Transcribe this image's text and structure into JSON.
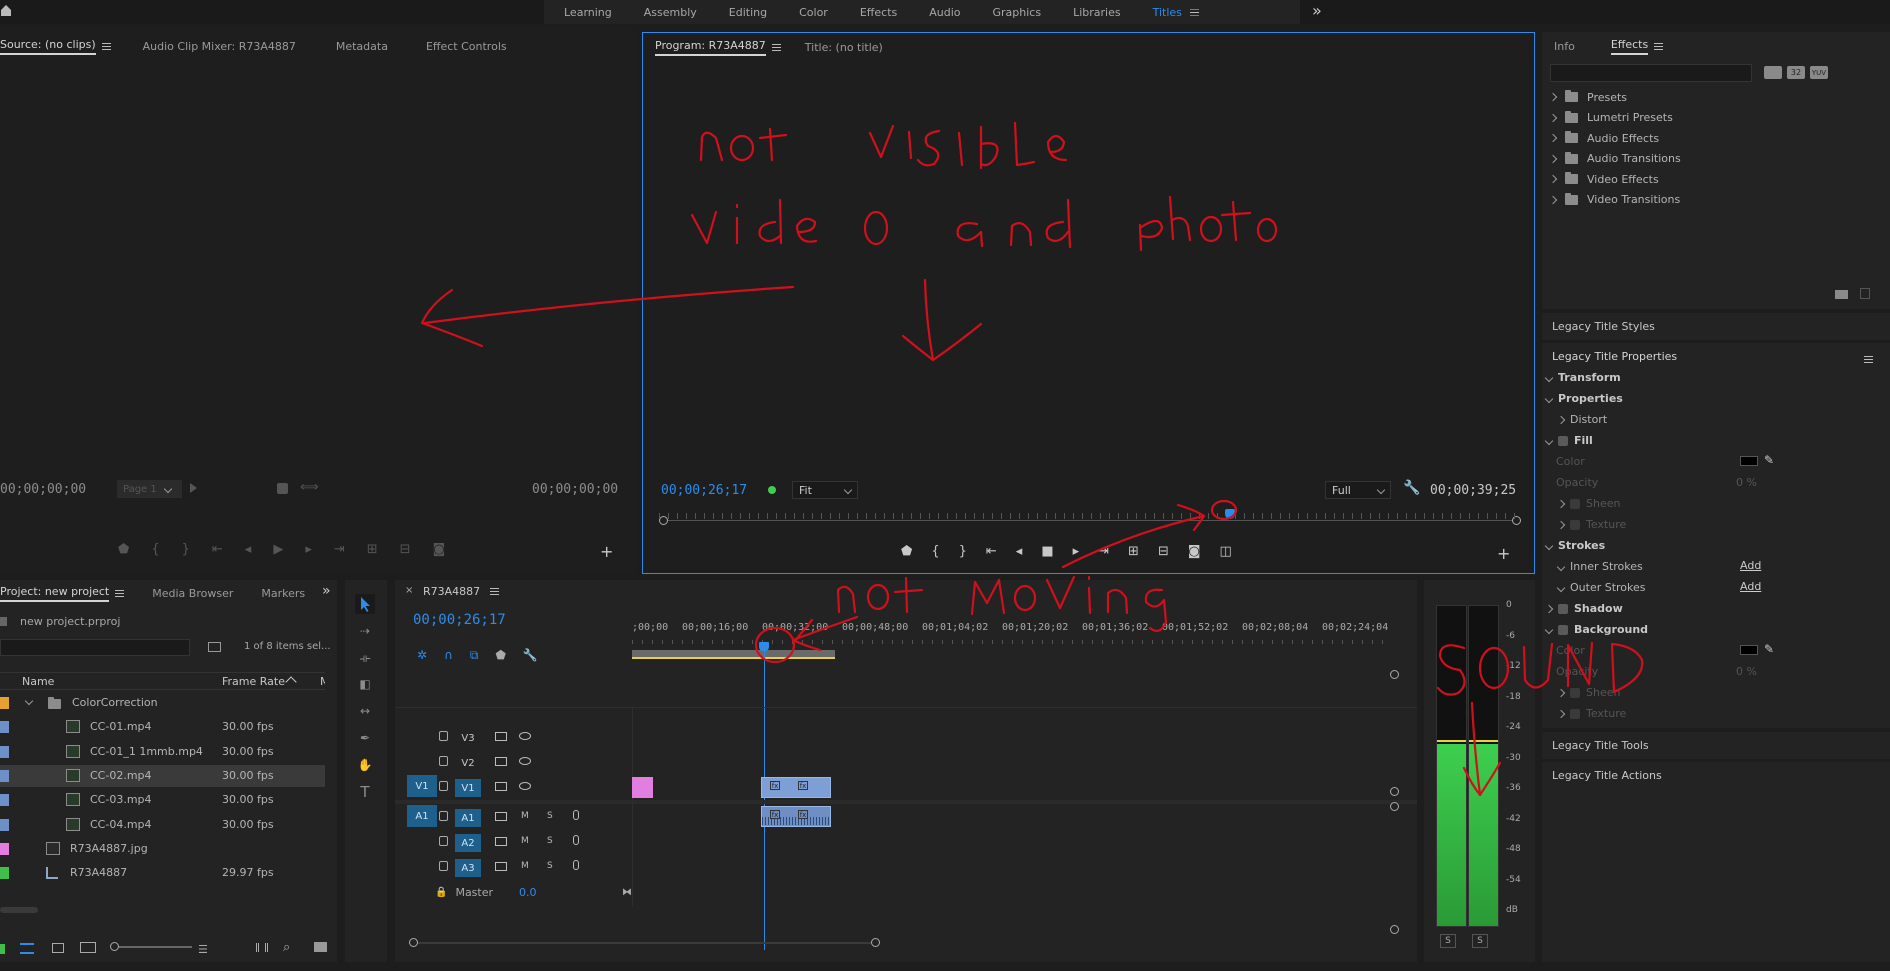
{
  "workspaces": {
    "items": [
      "Learning",
      "Assembly",
      "Editing",
      "Color",
      "Effects",
      "Audio",
      "Graphics",
      "Libraries",
      "Titles"
    ],
    "active": "Titles",
    "overflow": "»"
  },
  "source_panel": {
    "tabs": [
      "Source: (no clips)",
      "Audio Clip Mixer: R73A4887",
      "Metadata",
      "Effect Controls"
    ],
    "timecode_left": "00;00;00;00",
    "page_select": "Page 1",
    "timecode_right": "00;00;00;00"
  },
  "program_panel": {
    "tabs": [
      "Program: R73A4887",
      "Title: (no title)"
    ],
    "timecode": "00;00;26;17",
    "zoom": "Fit",
    "quality": "Full",
    "duration": "00;00;39;25"
  },
  "effects_panel": {
    "tabs": [
      "Info",
      "Effects"
    ],
    "items": [
      "Presets",
      "Lumetri Presets",
      "Audio Effects",
      "Audio Transitions",
      "Video Effects",
      "Video Transitions"
    ],
    "badge_32": "32",
    "badge_yuv": "YUV"
  },
  "legacy_title": {
    "styles": "Legacy Title Styles",
    "properties": "Legacy Title Properties",
    "transform": "Transform",
    "properties_section": "Properties",
    "distort": "Distort",
    "fill": "Fill",
    "color": "Color",
    "opacity": "Opacity",
    "opacity_value": "0 %",
    "sheen": "Sheen",
    "texture": "Texture",
    "strokes": "Strokes",
    "inner_strokes": "Inner Strokes",
    "outer_strokes": "Outer Strokes",
    "add": "Add",
    "shadow": "Shadow",
    "background": "Background",
    "bg_color": "Color",
    "bg_opacity": "Opacity",
    "bg_opacity_value": "0 %",
    "bg_sheen": "Sheen",
    "bg_texture": "Texture",
    "tools": "Legacy Title Tools",
    "actions": "Legacy Title Actions"
  },
  "project_panel": {
    "tabs": [
      "Project: new project",
      "Media Browser",
      "Markers"
    ],
    "file": "new project.prproj",
    "selection_info": "1 of 8 items sel...",
    "col_name": "Name",
    "col_rate": "Frame Rate",
    "col_extra": "M",
    "items": [
      {
        "name": "ColorCorrection",
        "rate": "",
        "color": "#e8a030",
        "indent": 0,
        "kind": "folder"
      },
      {
        "name": "CC-01.mp4",
        "rate": "30.00 fps",
        "color": "#6e8fc8",
        "indent": 1,
        "kind": "clip"
      },
      {
        "name": "CC-01_1 1mmb.mp4",
        "rate": "30.00 fps",
        "color": "#6e8fc8",
        "indent": 1,
        "kind": "clip"
      },
      {
        "name": "CC-02.mp4",
        "rate": "30.00 fps",
        "color": "#6e8fc8",
        "indent": 1,
        "kind": "clip"
      },
      {
        "name": "CC-03.mp4",
        "rate": "30.00 fps",
        "color": "#6e8fc8",
        "indent": 1,
        "kind": "clip"
      },
      {
        "name": "CC-04.mp4",
        "rate": "30.00 fps",
        "color": "#6e8fc8",
        "indent": 1,
        "kind": "clip"
      },
      {
        "name": "R73A4887.jpg",
        "rate": "",
        "color": "#e27ee0",
        "indent": 0,
        "kind": "image"
      },
      {
        "name": "R73A4887",
        "rate": "29.97 fps",
        "color": "#3fbf4a",
        "indent": 0,
        "kind": "sequence"
      }
    ]
  },
  "timeline": {
    "tab": "R73A4887",
    "timecode": "00;00;26;17",
    "ruler": [
      ";00;00",
      "00;00;16;00",
      "00;00;32;00",
      "00;00;48;00",
      "00;01;04;02",
      "00;01;20;02",
      "00;01;36;02",
      "00;01;52;02",
      "00;02;08;04",
      "00;02;24;04"
    ],
    "video_tracks": [
      "V3",
      "V2",
      "V1"
    ],
    "audio_tracks": [
      "A1",
      "A2",
      "A3"
    ],
    "source_v": "V1",
    "source_a": "A1",
    "master": "Master",
    "master_value": "0.0",
    "m": "M",
    "s": "S"
  },
  "meter": {
    "scale": [
      "0",
      "-6",
      "-12",
      "-18",
      "-24",
      "-30",
      "-36",
      "-42",
      "-48",
      "-54",
      "dB"
    ],
    "solo_left": "S",
    "solo_right": "S"
  },
  "annotations": {
    "a1": "not visible",
    "a2": "video and photo",
    "a3": "not moving",
    "a4": "sound"
  },
  "colors": {
    "accent": "#2d8ceb",
    "annotation": "#d0101c",
    "meter_green": "#3ecf4f"
  }
}
